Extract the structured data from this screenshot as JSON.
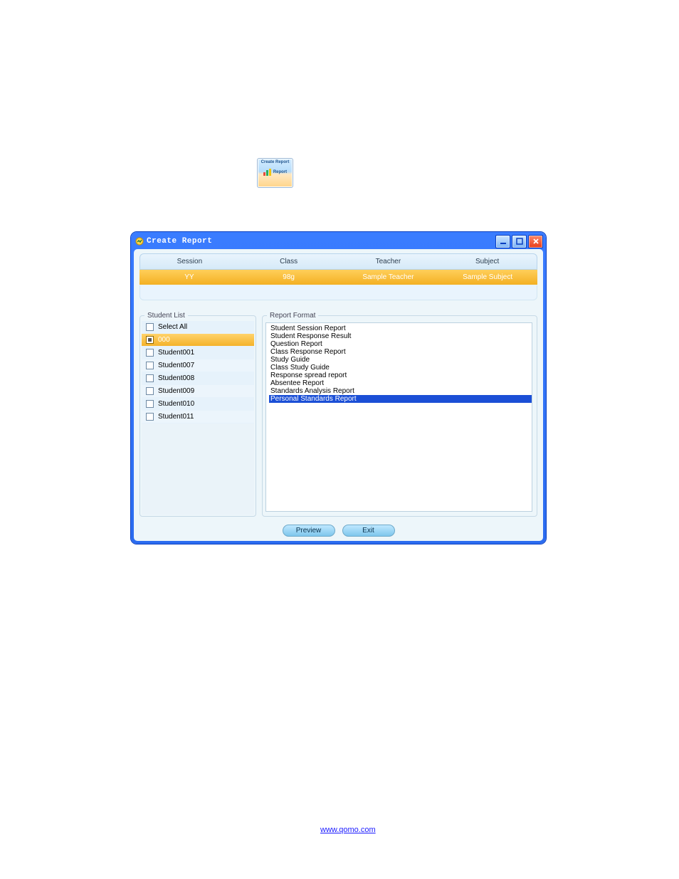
{
  "toolbar_preview": {
    "label_top": "Create Report",
    "label_bottom": "Report"
  },
  "dialog": {
    "title": "Create Report",
    "window_controls": {
      "min": "−",
      "max": "□",
      "close": "X"
    },
    "headers": {
      "session": "Session",
      "class": "Class",
      "teacher": "Teacher",
      "subject": "Subject"
    },
    "values": {
      "session": "YY",
      "class": "98g",
      "teacher": "Sample Teacher",
      "subject": "Sample Subject"
    },
    "student_panel_title": "Student List",
    "format_panel_title": "Report Format",
    "students": [
      {
        "label": "Select All",
        "selected": false
      },
      {
        "label": "000",
        "selected": true
      },
      {
        "label": "Student001",
        "selected": false
      },
      {
        "label": "Student007",
        "selected": false
      },
      {
        "label": "Student008",
        "selected": false
      },
      {
        "label": "Student009",
        "selected": false
      },
      {
        "label": "Student010",
        "selected": false
      },
      {
        "label": "Student011",
        "selected": false
      }
    ],
    "formats": [
      {
        "label": "Student Session Report",
        "selected": false
      },
      {
        "label": "Student Response Result",
        "selected": false
      },
      {
        "label": "Question Report",
        "selected": false
      },
      {
        "label": "Class Response Report",
        "selected": false
      },
      {
        "label": "Study Guide",
        "selected": false
      },
      {
        "label": "Class Study Guide",
        "selected": false
      },
      {
        "label": "Response spread report",
        "selected": false
      },
      {
        "label": "Absentee Report",
        "selected": false
      },
      {
        "label": "Standards Analysis Report",
        "selected": false
      },
      {
        "label": "Personal Standards Report",
        "selected": true
      }
    ],
    "buttons": {
      "preview": "Preview",
      "exit": "Exit"
    }
  },
  "footer_link": "www.qomo.com"
}
